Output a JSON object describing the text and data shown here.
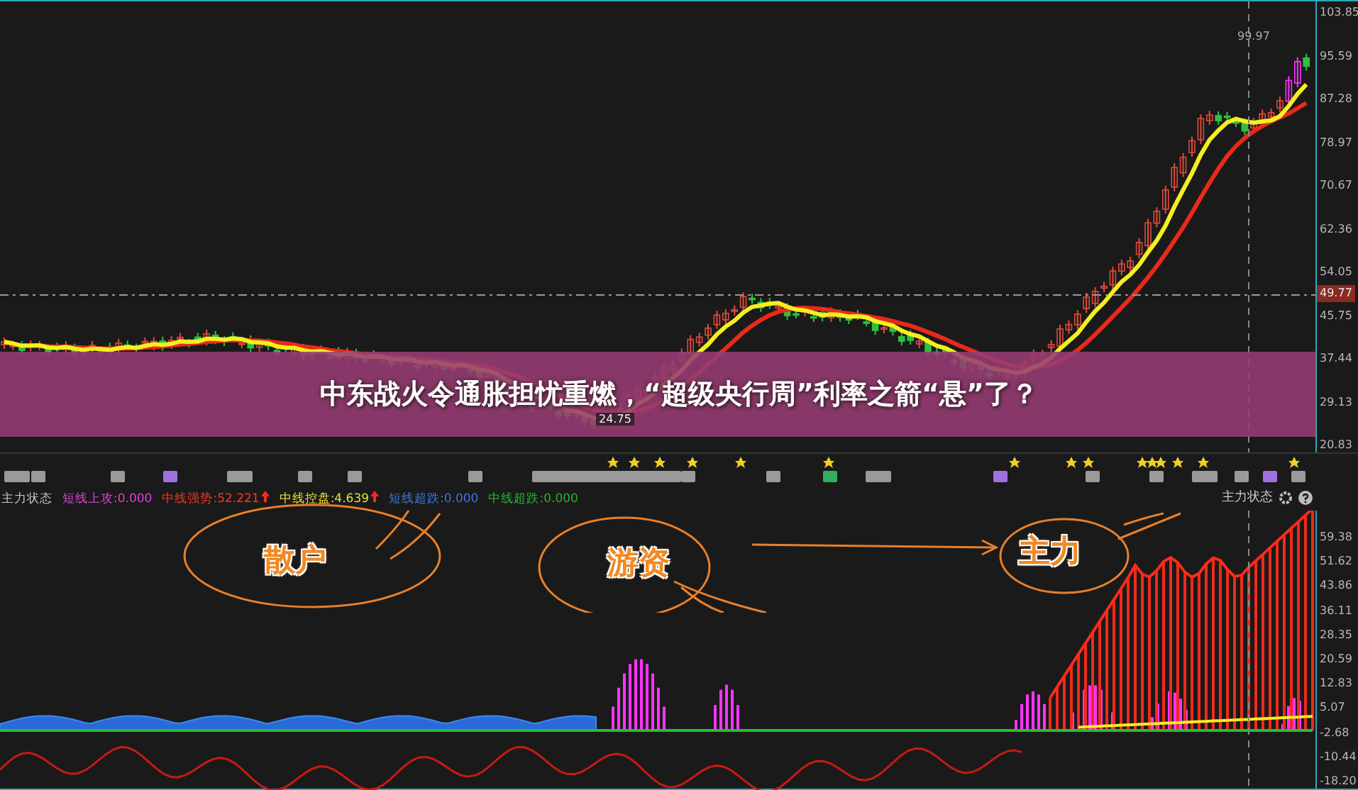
{
  "headline": "中东战火令通胀担忧重燃，“超级央行周”利率之箭“悬”了？",
  "price_axis": {
    "ticks": [
      "103.85",
      "95.59",
      "87.28",
      "78.97",
      "70.67",
      "62.36",
      "54.05",
      "45.75",
      "37.44",
      "29.13",
      "20.83"
    ],
    "current_price": "49.77"
  },
  "price_markers": {
    "high": "99.97",
    "low": "24.75"
  },
  "indicator": {
    "name": "主力状态",
    "values": [
      {
        "label": "短线上攻:0.000",
        "color": "#e040e0",
        "arrow": false
      },
      {
        "label": "中线强势:52.221",
        "color": "#ff3322",
        "arrow": true
      },
      {
        "label": "中线控盘:4.639",
        "color": "#e8e030",
        "arrow": true
      },
      {
        "label": "短线超跌:0.000",
        "color": "#3a78e0",
        "arrow": false
      },
      {
        "label": "中线超跌:0.000",
        "color": "#22b830",
        "arrow": false
      }
    ],
    "panel_title": "主力状态",
    "axis_ticks": [
      "59.38",
      "51.62",
      "43.86",
      "36.11",
      "28.35",
      "20.59",
      "12.83",
      "5.07",
      "-2.68",
      "-10.44",
      "-18.20"
    ]
  },
  "annotations": [
    {
      "text": "散户"
    },
    {
      "text": "游资"
    },
    {
      "text": "主力"
    }
  ]
}
